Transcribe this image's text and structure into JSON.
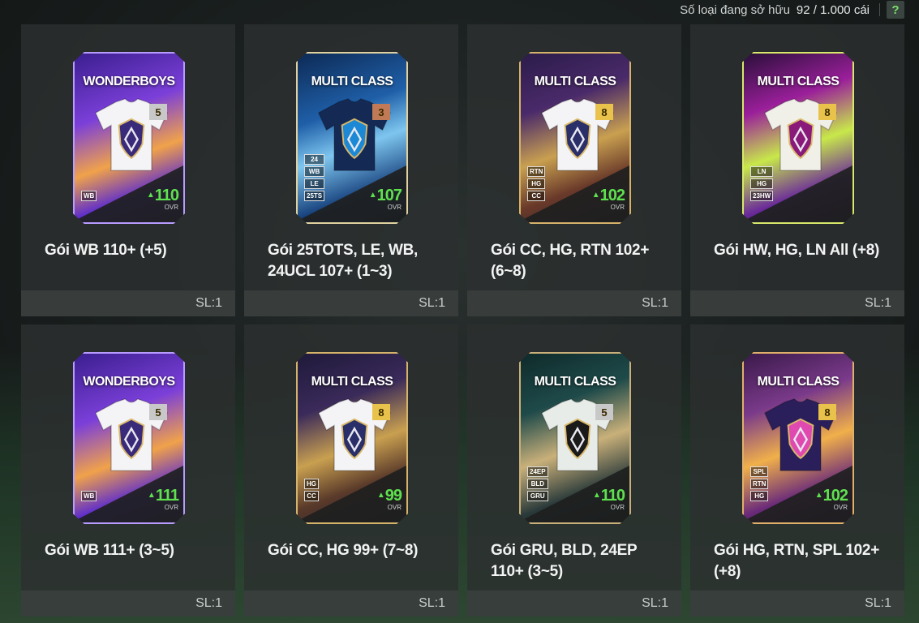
{
  "header": {
    "owned_label": "Số loại đang sở hữu",
    "owned_count": "92 / 1.000 cái",
    "help_glyph": "?"
  },
  "tiles": [
    {
      "name": "Gói WB 110+ (+5)",
      "qty": "SL:1",
      "card_title": "WONDERBOYS",
      "level": "5",
      "tags": [
        "WB"
      ],
      "ovr_value": "110",
      "ovr_label": "OVR"
    },
    {
      "name": "Gói 25TOTS, LE, WB, 24UCL 107+ (1~3)",
      "qty": "SL:1",
      "card_title": "MULTI CLASS",
      "level": "3",
      "tags": [
        "24",
        "WB",
        "LE",
        "25TS"
      ],
      "ovr_value": "107",
      "ovr_label": "OVR"
    },
    {
      "name": "Gói CC, HG, RTN 102+ (6~8)",
      "qty": "SL:1",
      "card_title": "MULTI CLASS",
      "level": "8",
      "tags": [
        "RTN",
        "HG",
        "CC"
      ],
      "ovr_value": "102",
      "ovr_label": "OVR"
    },
    {
      "name": "Gói HW, HG, LN All (+8)",
      "qty": "SL:1",
      "card_title": "MULTI CLASS",
      "level": "8",
      "tags": [
        "LN",
        "HG",
        "23HW"
      ],
      "ovr_value": "",
      "ovr_label": ""
    },
    {
      "name": "Gói WB 111+ (3~5)",
      "qty": "SL:1",
      "card_title": "WONDERBOYS",
      "level": "5",
      "tags": [
        "WB"
      ],
      "ovr_value": "111",
      "ovr_label": "OVR"
    },
    {
      "name": "Gói CC, HG 99+ (7~8)",
      "qty": "SL:1",
      "card_title": "MULTI CLASS",
      "level": "8",
      "tags": [
        "HG",
        "CC"
      ],
      "ovr_value": "99",
      "ovr_label": "OVR"
    },
    {
      "name": "Gói GRU, BLD, 24EP 110+ (3~5)",
      "qty": "SL:1",
      "card_title": "MULTI CLASS",
      "level": "5",
      "tags": [
        "24EP",
        "BLD",
        "GRU"
      ],
      "ovr_value": "110",
      "ovr_label": "OVR"
    },
    {
      "name": "Gói HG, RTN, SPL 102+ (+8)",
      "qty": "SL:1",
      "card_title": "MULTI CLASS",
      "level": "8",
      "tags": [
        "SPL",
        "RTN",
        "HG"
      ],
      "ovr_value": "102",
      "ovr_label": "OVR"
    }
  ],
  "colors": {
    "ovr_green": "#5fe04f",
    "level_gold": "#e8c24a",
    "level_grey": "#c8c8c8",
    "level_bronze": "#c07a55"
  }
}
